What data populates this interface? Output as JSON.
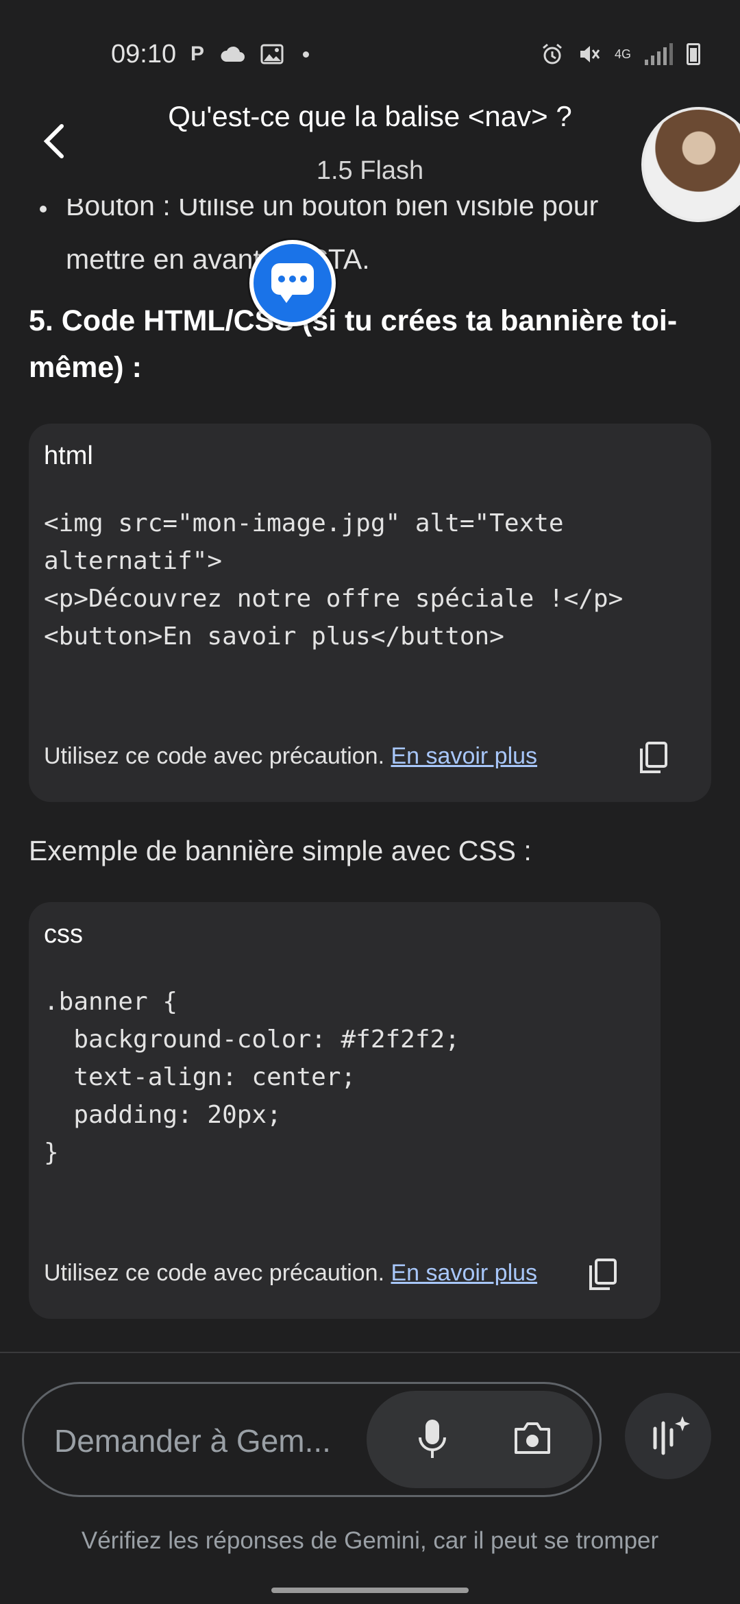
{
  "status_bar": {
    "time": "09:10",
    "network": "4G",
    "icons": [
      "parking-icon",
      "cloud-icon",
      "image-icon",
      "dot-icon",
      "alarm-icon",
      "mute-icon",
      "signal-icon",
      "battery-icon"
    ]
  },
  "header": {
    "title": "Qu'est-ce que la balise <nav> ?",
    "model": "1.5 Flash"
  },
  "content": {
    "bullet_partial_line1": "Bouton : Utilise un bouton bien visible pour",
    "bullet_partial_line2": "mettre en avant un CTA.",
    "section5_heading": "5. Code HTML/CSS (si tu crées ta bannière toi-même) :",
    "code_block_1": {
      "lang": "html",
      "code": "<img src=\"mon-image.jpg\" alt=\"Texte\nalternatif\">\n<p>Découvrez notre offre spéciale !</p>\n<button>En savoir plus</button>",
      "caution": "Utilisez ce code avec précaution.",
      "link": "En savoir plus"
    },
    "paragraph": "Exemple de bannière simple avec CSS :",
    "code_block_2": {
      "lang": "css",
      "code": ".banner {\n  background-color: #f2f2f2;\n  text-align: center;\n  padding: 20px;\n}",
      "caution": "Utilisez ce code avec précaution.",
      "link": "En savoir plus"
    }
  },
  "input": {
    "placeholder": "Demander à Gem..."
  },
  "disclaimer": "Vérifiez les réponses de Gemini, car il peut se tromper",
  "colors": {
    "background": "#1f1f20",
    "code_bg": "#2b2b2d",
    "link": "#a8c7fa",
    "bubble_blue": "#1a73e8"
  }
}
